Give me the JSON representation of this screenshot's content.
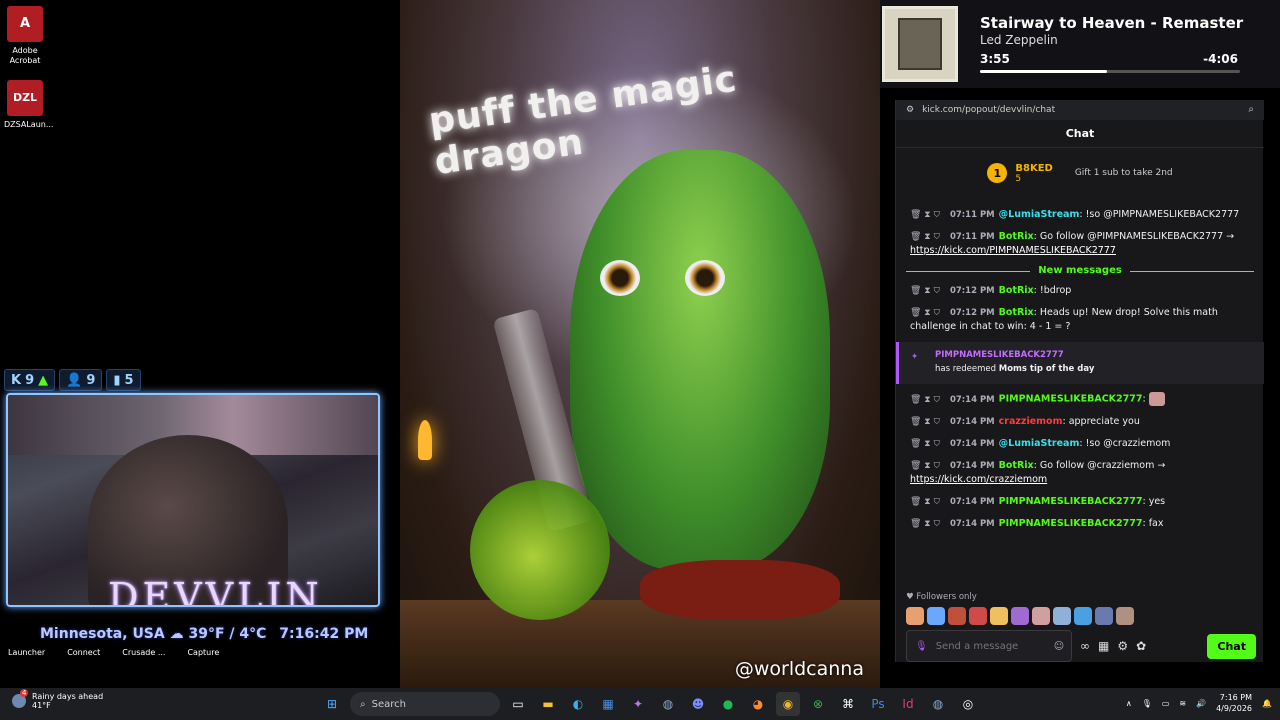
{
  "desktop": {
    "icons": [
      {
        "label": "Adobe Acrobat",
        "glyph": "A"
      },
      {
        "label": "DZSALaun...",
        "glyph": "DZL"
      }
    ]
  },
  "overlay": {
    "stats": [
      {
        "icon": "K",
        "value": "9"
      },
      {
        "icon": "person",
        "value": "9"
      },
      {
        "icon": "bars",
        "value": "5"
      }
    ],
    "logo": "DEVVLIN",
    "location": "Minnesota, USA",
    "weather": "39°F / 4°C",
    "time": "7:16:42 PM",
    "shortcuts": [
      "Launcher",
      "Connect",
      "Crusade ...",
      "Capture"
    ]
  },
  "art": {
    "title": "puff the magic dragon",
    "credit": "@worldcanna"
  },
  "music": {
    "song": "Stairway to Heaven - Remaster",
    "artist": "Led Zeppelin",
    "current": "3:55",
    "remaining": "-4:06",
    "progress": 0.49
  },
  "chat": {
    "url": "kick.com/popout/devvlin/chat",
    "header": "Chat",
    "pinned": {
      "rank": "1",
      "user": "B8KED",
      "count": "5",
      "gift": "Gift 1 sub to take 2nd"
    },
    "messages": [
      {
        "time": "07:11 PM",
        "user": "@LumiaStream",
        "text": "!so @PIMPNAMESLIKEBACK2777"
      },
      {
        "time": "07:11 PM",
        "user": "BotRix",
        "text": "Go follow @PIMPNAMESLIKEBACK2777 →",
        "link": "https://kick.com/PIMPNAMESLIKEBACK2777"
      }
    ],
    "new_messages": "New messages",
    "messages2": [
      {
        "time": "07:12 PM",
        "user": "BotRix",
        "text": "!bdrop"
      },
      {
        "time": "07:12 PM",
        "user": "BotRix",
        "text": "Heads up! New drop! Solve this math challenge in chat to win: 4 - 1 = ?"
      }
    ],
    "redeem": {
      "user": "PIMPNAMESLIKEBACK2777",
      "prefix": "has redeemed",
      "reward": "Moms tip of the day"
    },
    "messages3": [
      {
        "time": "07:14 PM",
        "user": "PIMPNAMESLIKEBACK2777",
        "text": ""
      },
      {
        "time": "07:14 PM",
        "user": "crazziemom",
        "text": "appreciate you"
      },
      {
        "time": "07:14 PM",
        "user": "@LumiaStream",
        "text": "!so @crazziemom"
      },
      {
        "time": "07:14 PM",
        "user": "BotRix",
        "text": "Go follow @crazziemom →",
        "link": "https://kick.com/crazziemom"
      },
      {
        "time": "07:14 PM",
        "user": "PIMPNAMESLIKEBACK2777",
        "text": "yes"
      },
      {
        "time": "07:14 PM",
        "user": "PIMPNAMESLIKEBACK2777",
        "text": "fax"
      }
    ],
    "followers_only": "Followers only",
    "input_placeholder": "Send a message",
    "send": "Chat"
  },
  "taskbar": {
    "weather_title": "Rainy days ahead",
    "weather_temp": "41°F",
    "weather_badge": "4",
    "search": "Search",
    "time": "7:16 PM",
    "date": "4/9/2026"
  },
  "colors": {
    "kick_green": "#53fc18",
    "accent_purple": "#b057ff",
    "rank_gold": "#f4b400"
  }
}
